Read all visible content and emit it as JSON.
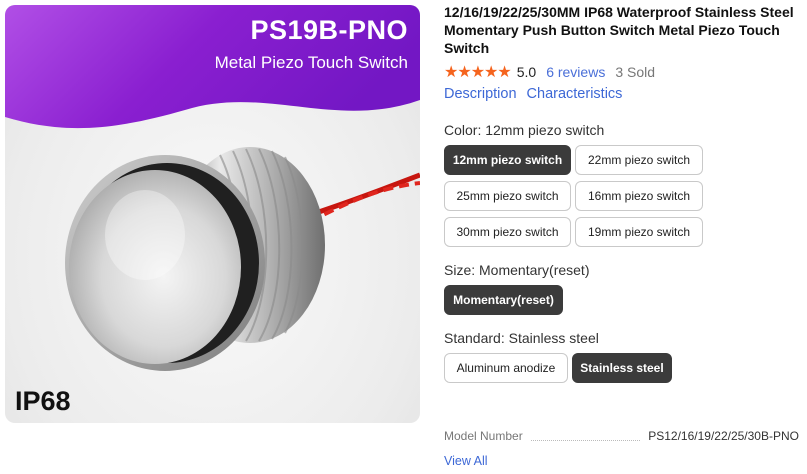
{
  "image": {
    "banner_title": "PS19B-PNO",
    "banner_subtitle": "Metal Piezo Touch Switch",
    "badge": "IP68",
    "banner_color": "#8a1fd0"
  },
  "product": {
    "title": "12/16/19/22/25/30MM IP68 Waterproof Stainless Steel Momentary Push Button Switch Metal Piezo Touch Switch",
    "stars": "★★★★★",
    "score": "5.0",
    "reviews": "6 reviews",
    "sold": "3 Sold",
    "star_color": "#f5641e"
  },
  "tabs": [
    "Description",
    "Characteristics"
  ],
  "color_group": {
    "label": "Color: 12mm piezo switch",
    "options": [
      "12mm piezo switch",
      "22mm piezo switch",
      "25mm piezo switch",
      "16mm piezo switch",
      "30mm piezo switch",
      "19mm piezo switch"
    ],
    "selected": "12mm piezo switch"
  },
  "size_group": {
    "label": "Size: Momentary(reset)",
    "options": [
      "Momentary(reset)"
    ],
    "selected": "Momentary(reset)"
  },
  "standard_group": {
    "label": "Standard: Stainless steel",
    "options": [
      "Aluminum anodize",
      "Stainless steel"
    ],
    "selected": "Stainless steel"
  },
  "specs": {
    "key": "Model Number",
    "value": "PS12/16/19/22/25/30B-PNO",
    "view_all": "View All"
  },
  "colors": {
    "link": "#3d68d6",
    "selected_bg": "#3b3b3b"
  }
}
